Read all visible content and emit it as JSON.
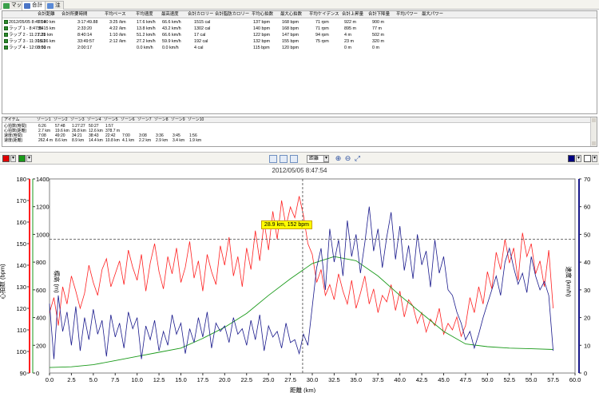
{
  "tabs": [
    {
      "label": "マップ",
      "icon": "map-icon",
      "color": "#3aa04a"
    },
    {
      "label": "合計",
      "icon": "table-icon",
      "color": "#4a74c6"
    },
    {
      "label": "注",
      "icon": "note-icon",
      "color": "#5a8ad6"
    }
  ],
  "laps": {
    "headers": [
      "合計距離",
      "合計所要時間",
      "平均ペース",
      "平均速度",
      "最高速度",
      "合計カロリー",
      "合計脂肪カロリー",
      "平均心拍数",
      "最大心拍数",
      "平均ケイデンス",
      "合計上昇量",
      "合計下降量",
      "平均パワー",
      "最大パワー"
    ],
    "rows": [
      {
        "name": "2012/05/05 8:47:54",
        "dist": "57.90 km",
        "time": "3:17:49.88",
        "pace": "3:25 /km",
        "speed": "17.6 km/h",
        "max_speed": "66.6 km/h",
        "cal": "1515 cal",
        "fat_cal": "",
        "avg_hr": "137 bpm",
        "max_hr": "168 bpm",
        "cad": "71 rpm",
        "up": "922 m",
        "down": "900 m",
        "avg_pw": "",
        "max_pw": ""
      },
      {
        "name": "ラップ 1 - 8:47:54",
        "dist": "35.15 km",
        "time": "2:33:20",
        "pace": "4:22 /km",
        "speed": "13.8 km/h",
        "max_speed": "43.2 km/h",
        "cal": "1302 cal",
        "fat_cal": "",
        "avg_hr": "140 bpm",
        "max_hr": "168 bpm",
        "cad": "71 rpm",
        "up": "895 m",
        "down": "77 m",
        "avg_pw": "",
        "max_pw": ""
      },
      {
        "name": "ラップ 2 - 11:21:21",
        "dist": "7.39 km",
        "time": "8:40:14",
        "pace": "1:10 /km",
        "speed": "51.2 km/h",
        "max_speed": "66.6 km/h",
        "cal": "17 cal",
        "fat_cal": "",
        "avg_hr": "122 bpm",
        "max_hr": "147 bpm",
        "cad": "94 rpm",
        "up": "4 m",
        "down": "502 m",
        "avg_pw": "",
        "max_pw": ""
      },
      {
        "name": "ラップ 3 - 11:30:01",
        "dist": "15.36 km",
        "time": "33:49:57",
        "pace": "2:12 /km",
        "speed": "27.2 km/h",
        "max_speed": "59.9 km/h",
        "cal": "192 cal",
        "fat_cal": "",
        "avg_hr": "132 bpm",
        "max_hr": "155 bpm",
        "cad": "75 rpm",
        "up": "23 m",
        "down": "320 m",
        "avg_pw": "",
        "max_pw": ""
      },
      {
        "name": "ラップ 4 - 12:03:51",
        "dist": "0.00 m",
        "time": "2:00:17",
        "pace": "",
        "speed": "0.0 km/h",
        "max_speed": "0.0 km/h",
        "cal": "4 cal",
        "fat_cal": "",
        "avg_hr": "115 bpm",
        "max_hr": "120 bpm",
        "cad": "",
        "up": "0 m",
        "down": "0 m",
        "avg_pw": "",
        "max_pw": ""
      }
    ]
  },
  "zones": {
    "header_item": "アイテム",
    "zone_labels": [
      "ゾーン1",
      "ゾーン2",
      "ゾーン3",
      "ゾーン4",
      "ゾーン5",
      "ゾーン6",
      "ゾーン7",
      "ゾーン8",
      "ゾーン9",
      "ゾーン10"
    ],
    "rows": [
      {
        "label": "心拍数(時間)",
        "values": [
          "6:26",
          "57:48",
          "1:27:27",
          "50:27",
          "1:57",
          "",
          "",
          "",
          "",
          ""
        ]
      },
      {
        "label": "心拍数(距離)",
        "values": [
          "2.7 km",
          "19.6 km",
          "26.8 km",
          "12.6 km",
          "378.7 m",
          "",
          "",
          "",
          "",
          ""
        ]
      },
      {
        "label": "速度(時間)",
        "values": [
          "7:08",
          "49:20",
          "34:21",
          "38:43",
          "22:42",
          "7:00",
          "3:08",
          "3:36",
          "3:45",
          "1:56"
        ]
      },
      {
        "label": "速度(距離)",
        "values": [
          "262.4 m",
          "8.6 km",
          "8.9 km",
          "14.4 km",
          "10.8 km",
          "4.1 km",
          "2.2 km",
          "2.9 km",
          "3.4 km",
          "1.9 km"
        ]
      }
    ]
  },
  "toolbar": {
    "left_color": "#e00000",
    "left_color2": "#1a9a1a",
    "right_color": "#000080",
    "xaxis_select": "距離"
  },
  "chart_title": "2012/05/05 8:47:54",
  "tooltip": "28.9 km, 152 bpm",
  "chart_data": {
    "type": "line",
    "title": "2012/05/05 8:47:54",
    "xlabel": "距離 (km)",
    "y_left_outer_label": "心拍数 (bpm)",
    "y_left_inner_label": "標高 (m)",
    "y_right_label": "速度 (km/h)",
    "x_ticks": [
      "0.0",
      "2.5",
      "5.0",
      "7.5",
      "10.0",
      "12.5",
      "15.0",
      "17.5",
      "20.0",
      "22.5",
      "25.0",
      "27.5",
      "30.0",
      "32.5",
      "35.0",
      "37.5",
      "40.0",
      "42.5",
      "45.0",
      "47.5",
      "50.0",
      "52.5",
      "55.0",
      "57.5",
      "60.0"
    ],
    "hr_ticks": [
      "90",
      "100",
      "110",
      "120",
      "130",
      "140",
      "150",
      "160",
      "170",
      "180"
    ],
    "elev_ticks": [
      "0",
      "200",
      "400",
      "600",
      "800",
      "1000",
      "1200",
      "1400"
    ],
    "speed_ticks": [
      "0",
      "10",
      "20",
      "30",
      "40",
      "50",
      "60",
      "70"
    ],
    "xlim": [
      0,
      60
    ],
    "hr_lim": [
      90,
      180
    ],
    "elev_lim": [
      0,
      1400
    ],
    "speed_lim": [
      0,
      70
    ],
    "crosshair": {
      "x": 28.9,
      "hr": 152
    },
    "colors": {
      "hr": "#ff2020",
      "elevation": "#1a9a1a",
      "speed": "#1a1a8c"
    },
    "series": [
      {
        "name": "心拍数",
        "axis": "hr",
        "x": [
          0,
          0.5,
          1,
          1.5,
          2,
          2.5,
          3,
          3.5,
          4,
          4.5,
          5,
          5.5,
          6,
          6.5,
          7,
          7.5,
          8,
          8.5,
          9,
          9.5,
          10,
          10.5,
          11,
          11.5,
          12,
          12.5,
          13,
          13.5,
          14,
          14.5,
          15,
          15.5,
          16,
          16.5,
          17,
          17.5,
          18,
          18.5,
          19,
          19.5,
          20,
          20.5,
          21,
          21.5,
          22,
          22.5,
          23,
          23.5,
          24,
          24.5,
          25,
          25.5,
          26,
          26.5,
          27,
          27.5,
          28,
          28.5,
          29,
          29.5,
          30,
          30.5,
          31,
          31.5,
          32,
          32.5,
          33,
          33.5,
          34,
          34.5,
          35,
          35.5,
          36,
          36.5,
          37,
          37.5,
          38,
          38.5,
          39,
          39.5,
          40,
          40.5,
          41,
          41.5,
          42,
          42.5,
          43,
          43.5,
          44,
          44.5,
          45,
          45.5,
          46,
          46.5,
          47,
          47.5,
          48,
          48.5,
          49,
          49.5,
          50,
          50.5,
          51,
          51.5,
          52,
          52.5,
          53,
          53.5,
          54,
          54.5,
          55,
          55.5,
          56,
          56.5,
          57,
          57.5
        ],
        "y": [
          118,
          125,
          112,
          130,
          122,
          135,
          128,
          120,
          127,
          140,
          132,
          126,
          138,
          143,
          130,
          136,
          142,
          131,
          147,
          139,
          133,
          145,
          128,
          141,
          150,
          137,
          129,
          144,
          136,
          148,
          132,
          139,
          151,
          134,
          142,
          128,
          145,
          137,
          131,
          149,
          140,
          153,
          135,
          144,
          130,
          148,
          138,
          156,
          142,
          160,
          147,
          165,
          152,
          170,
          158,
          167,
          162,
          172,
          163,
          150,
          145,
          132,
          138,
          126,
          131,
          124,
          136,
          128,
          122,
          133,
          120,
          127,
          135,
          122,
          129,
          118,
          126,
          123,
          131,
          119,
          128,
          116,
          124,
          121,
          113,
          118,
          109,
          115,
          112,
          120,
          108,
          113,
          110,
          116,
          107,
          112,
          125,
          118,
          130,
          122,
          137,
          129,
          146,
          138,
          152,
          141,
          148,
          133,
          155,
          144,
          150,
          136,
          142,
          130,
          147,
          120
        ],
        "values_note": ""
      },
      {
        "name": "標高",
        "axis": "elev",
        "x": [
          0,
          2.5,
          5,
          7.5,
          10,
          12.5,
          15,
          17.5,
          20,
          22.5,
          25,
          27.5,
          30,
          32.5,
          35,
          37.5,
          40,
          42.5,
          45,
          47.5,
          50,
          52.5,
          55,
          57.5
        ],
        "y": [
          40,
          45,
          60,
          90,
          120,
          150,
          180,
          250,
          330,
          430,
          560,
          680,
          790,
          840,
          810,
          700,
          560,
          430,
          300,
          210,
          190,
          180,
          175,
          170
        ]
      },
      {
        "name": "速度",
        "axis": "speed",
        "x": [
          0,
          0.5,
          1,
          1.5,
          2,
          2.5,
          3,
          3.5,
          4,
          4.5,
          5,
          5.5,
          6,
          6.5,
          7,
          7.5,
          8,
          8.5,
          9,
          9.5,
          10,
          10.5,
          11,
          11.5,
          12,
          12.5,
          13,
          13.5,
          14,
          14.5,
          15,
          15.5,
          16,
          16.5,
          17,
          17.5,
          18,
          18.5,
          19,
          19.5,
          20,
          20.5,
          21,
          21.5,
          22,
          22.5,
          23,
          23.5,
          24,
          24.5,
          25,
          25.5,
          26,
          26.5,
          27,
          27.5,
          28,
          28.5,
          29,
          29.5,
          30,
          30.5,
          31,
          31.5,
          32,
          32.5,
          33,
          33.5,
          34,
          34.5,
          35,
          35.5,
          36,
          36.5,
          37,
          37.5,
          38,
          38.5,
          39,
          39.5,
          40,
          40.5,
          41,
          41.5,
          42,
          42.5,
          43,
          43.5,
          44,
          44.5,
          45,
          45.5,
          46,
          46.5,
          47,
          47.5,
          48,
          48.5,
          49,
          49.5,
          50,
          50.5,
          51,
          51.5,
          52,
          52.5,
          53,
          53.5,
          54,
          54.5,
          55,
          55.5,
          56,
          56.5,
          57,
          57.5
        ],
        "y": [
          25,
          5,
          28,
          15,
          22,
          10,
          24,
          8,
          20,
          12,
          23,
          14,
          19,
          6,
          21,
          13,
          18,
          9,
          22,
          16,
          20,
          5,
          17,
          12,
          19,
          8,
          15,
          10,
          21,
          14,
          18,
          7,
          16,
          11,
          20,
          13,
          22,
          9,
          18,
          15,
          17,
          11,
          20,
          14,
          16,
          10,
          19,
          12,
          21,
          8,
          17,
          13,
          15,
          9,
          18,
          11,
          12,
          7,
          14,
          10,
          24,
          38,
          45,
          30,
          52,
          40,
          48,
          35,
          55,
          42,
          50,
          36,
          47,
          60,
          44,
          52,
          38,
          49,
          58,
          41,
          53,
          37,
          46,
          34,
          50,
          39,
          44,
          31,
          48,
          36,
          42,
          30,
          28,
          22,
          18,
          12,
          15,
          9,
          14,
          20,
          25,
          30,
          35,
          28,
          40,
          45,
          38,
          32,
          36,
          29,
          42,
          35,
          30,
          33,
          28,
          8
        ]
      }
    ]
  }
}
